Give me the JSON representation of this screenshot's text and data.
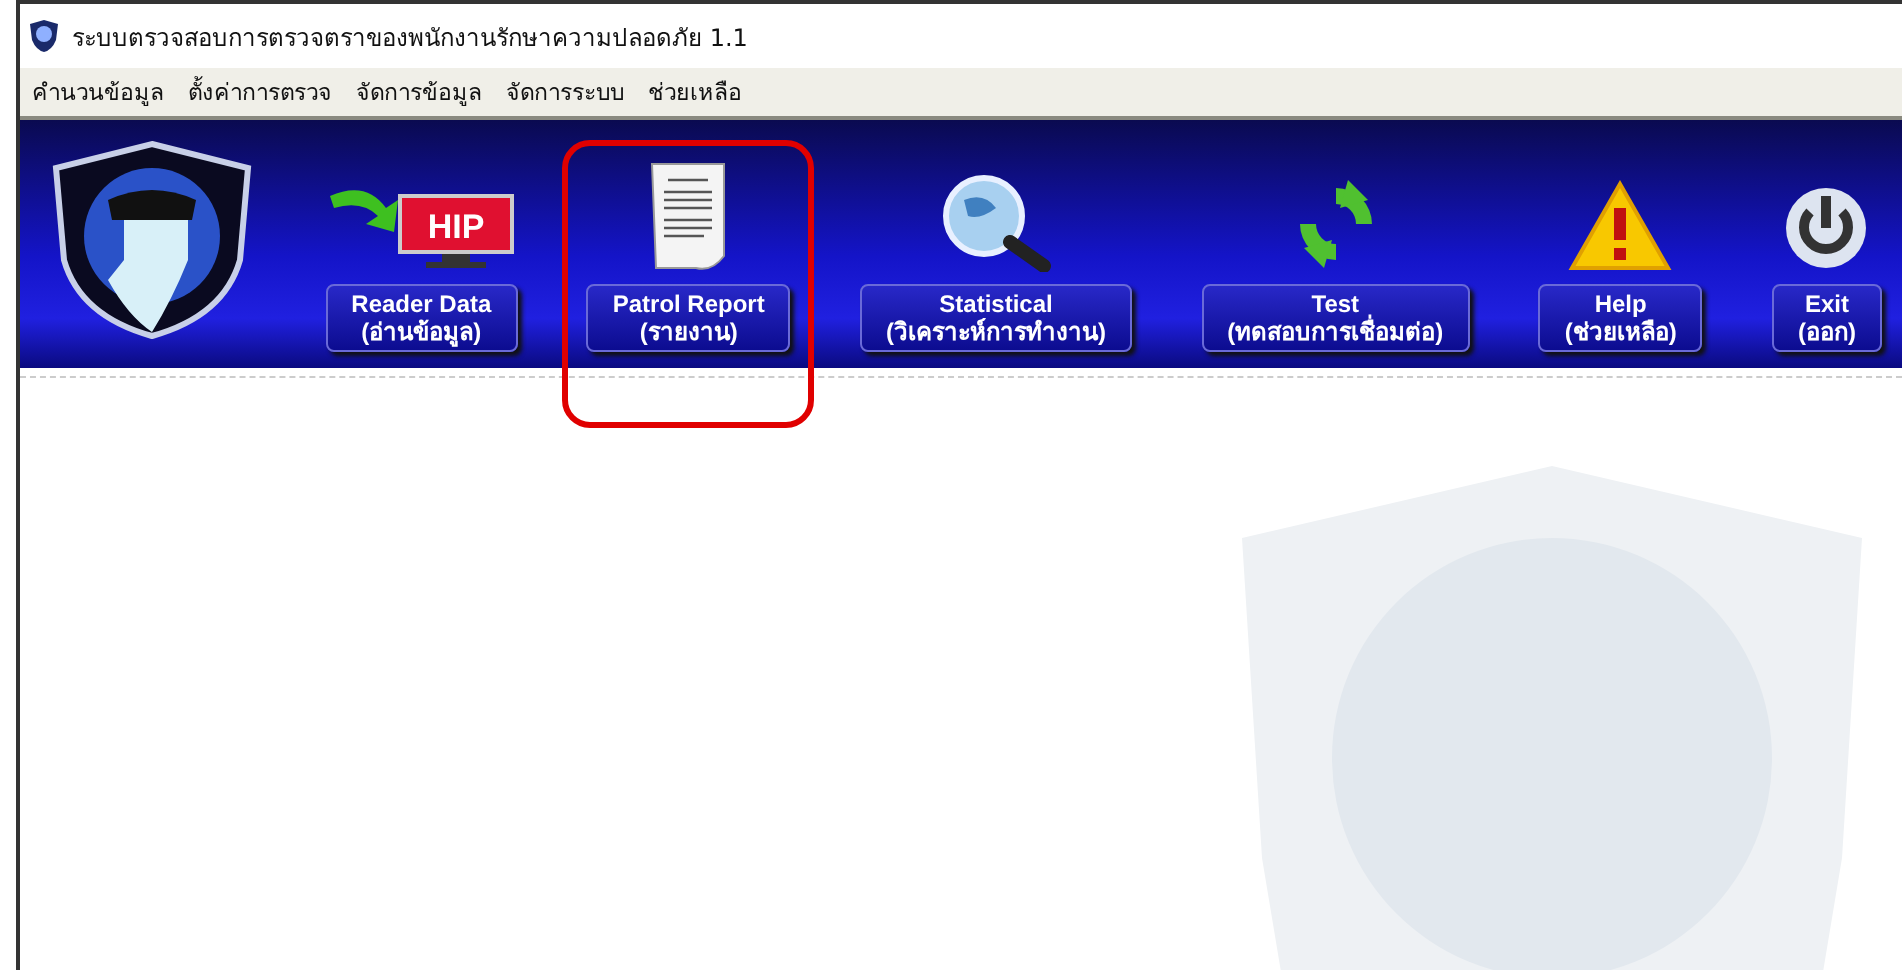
{
  "window": {
    "title": "ระบบตรวจสอบการตรวจตราของพนักงานรักษาความปลอดภัย 1.1"
  },
  "menu": [
    "คำนวนข้อมูล",
    "ตั้งค่าการตรวจ",
    "จัดการข้อมูล",
    "จัดการระบบ",
    "ช่วยเหลือ"
  ],
  "toolbar": [
    {
      "kind": "reader",
      "icon_text": "HIP",
      "label": "Reader Data",
      "sublabel": "(อ่านข้อมูล)",
      "highlighted": false
    },
    {
      "kind": "report",
      "label": "Patrol Report",
      "sublabel": "(รายงาน)",
      "highlighted": true
    },
    {
      "kind": "stats",
      "label": "Statistical",
      "sublabel": "(วิเคราะห์การทำงาน)",
      "highlighted": false
    },
    {
      "kind": "test",
      "label": "Test",
      "sublabel": "(ทดสอบการเชื่อมต่อ)",
      "highlighted": false
    },
    {
      "kind": "help",
      "label": "Help",
      "sublabel": "(ช่วยเหลือ)",
      "highlighted": false
    },
    {
      "kind": "exit",
      "label": "Exit",
      "sublabel": "(ออก)",
      "highlighted": false
    }
  ]
}
